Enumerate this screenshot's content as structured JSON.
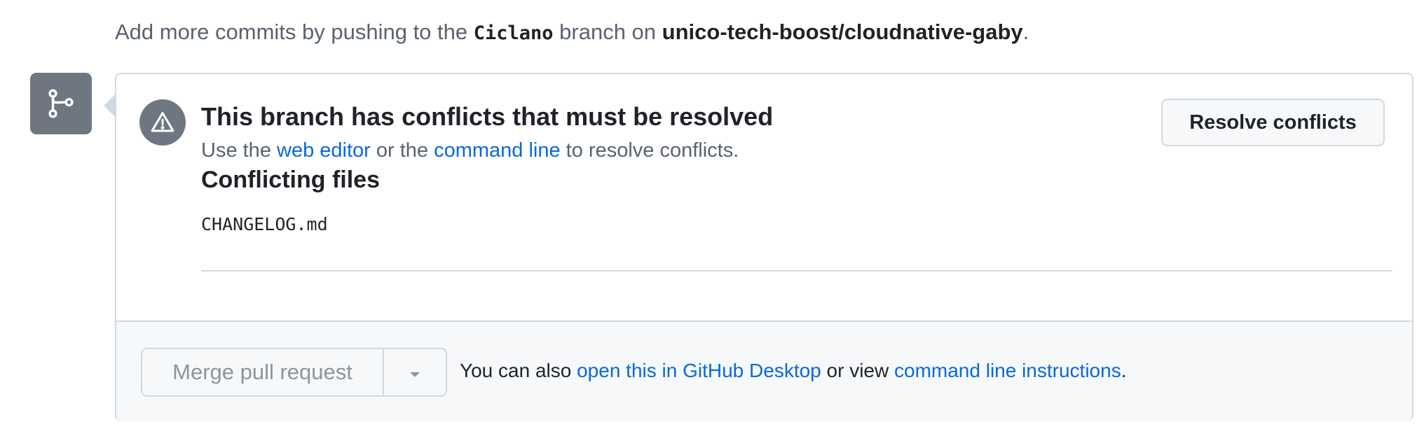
{
  "hint": {
    "prefix": "Add more commits by pushing to the ",
    "branch": "Ciclano",
    "middle": " branch on ",
    "repo": "unico-tech-boost/cloudnative-gaby",
    "suffix": "."
  },
  "icons": {
    "badge": "git-branch-icon",
    "alert": "alert-icon",
    "dropdown": "chevron-down-icon"
  },
  "conflict": {
    "title": "This branch has conflicts that must be resolved",
    "sub_prefix": "Use the ",
    "web_editor_link": "web editor",
    "sub_middle": " or the ",
    "command_line_link": "command line",
    "sub_suffix": " to resolve conflicts.",
    "files_heading": "Conflicting files",
    "files": [
      "CHANGELOG.md"
    ],
    "resolve_button": "Resolve conflicts"
  },
  "merge": {
    "button_label": "Merge pull request",
    "text_prefix": "You can also ",
    "desktop_link": "open this in GitHub Desktop",
    "text_middle": " or view ",
    "instructions_link": "command line instructions",
    "text_suffix": "."
  },
  "colors": {
    "link": "#0969da",
    "border": "#d1d9e0",
    "badge_bg": "#6e7781",
    "muted_text": "#59636e",
    "footer_bg": "#f6f8fa"
  }
}
